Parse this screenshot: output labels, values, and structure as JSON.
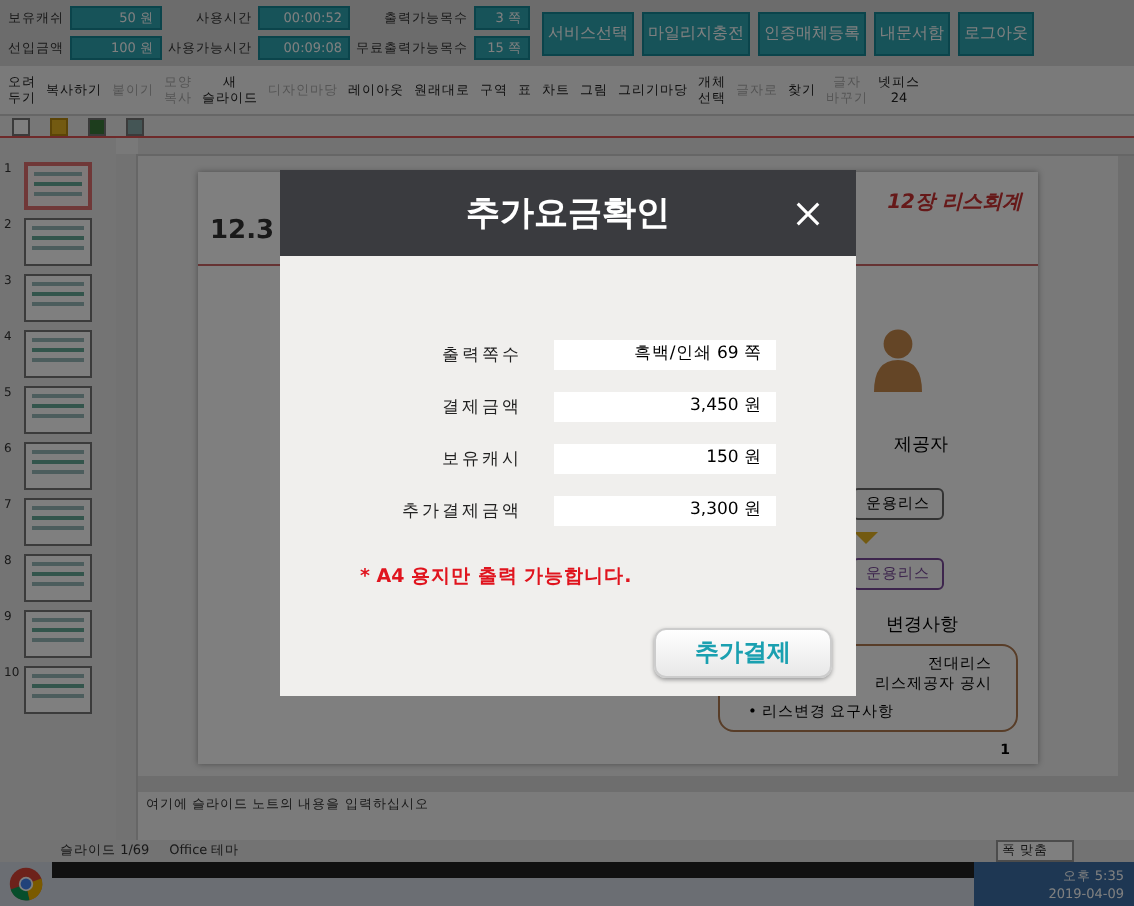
{
  "info_fields": [
    {
      "label": "보유캐쉬",
      "value": "50 원"
    },
    {
      "label": "사용시간",
      "value": "00:00:52"
    },
    {
      "label": "출력가능목수",
      "value": "3 쪽"
    },
    {
      "label": "선입금액",
      "value": "100 원"
    },
    {
      "label": "사용가능시간",
      "value": "00:09:08"
    },
    {
      "label": "무료출력가능목수",
      "value": "15 쪽"
    }
  ],
  "top_buttons": [
    "서비스선택",
    "마일리지충전",
    "인증매체등록",
    "내문서함",
    "로그아웃"
  ],
  "ribbon": [
    {
      "lines": [
        "오려",
        "두기"
      ],
      "disabled": false
    },
    {
      "lines": [
        "복사하기"
      ],
      "disabled": false
    },
    {
      "lines": [
        "붙이기"
      ],
      "disabled": true
    },
    {
      "lines": [
        "모양",
        "복사"
      ],
      "disabled": true
    },
    {
      "lines": [
        "새",
        "슬라이드"
      ],
      "disabled": false
    },
    {
      "lines": [
        "디자인마당"
      ],
      "disabled": true
    },
    {
      "lines": [
        "레이아웃"
      ],
      "disabled": false
    },
    {
      "lines": [
        "원래대로"
      ],
      "disabled": false
    },
    {
      "lines": [
        "구역"
      ],
      "disabled": false
    },
    {
      "lines": [
        "표"
      ],
      "disabled": false
    },
    {
      "lines": [
        "차트"
      ],
      "disabled": false
    },
    {
      "lines": [
        "그림"
      ],
      "disabled": false
    },
    {
      "lines": [
        "그리기마당"
      ],
      "disabled": false
    },
    {
      "lines": [
        "개체",
        "선택"
      ],
      "disabled": false
    },
    {
      "lines": [
        "글자로"
      ],
      "disabled": true
    },
    {
      "lines": [
        "찾기"
      ],
      "disabled": false
    },
    {
      "lines": [
        "글자",
        "바꾸기"
      ],
      "disabled": true
    },
    {
      "lines": [
        "넷피스",
        "24"
      ],
      "disabled": false
    }
  ],
  "thumbnails": [
    {
      "number": "1",
      "selected": true
    },
    {
      "number": "2",
      "selected": false
    },
    {
      "number": "3",
      "selected": false
    },
    {
      "number": "4",
      "selected": false
    },
    {
      "number": "5",
      "selected": false
    },
    {
      "number": "6",
      "selected": false
    },
    {
      "number": "7",
      "selected": false
    },
    {
      "number": "8",
      "selected": false
    },
    {
      "number": "9",
      "selected": false
    },
    {
      "number": "10",
      "selected": false
    }
  ],
  "slide": {
    "title": "12.3",
    "chapter": "12장 리스회계",
    "heading_1": "제공자",
    "tags": [
      "운용리스",
      "운용리스"
    ],
    "heading_2": "변경사항",
    "box_lines": [
      "전대리스",
      "리스제공자 공시"
    ],
    "bullet": "• 리스변경 요구사항",
    "page_number": "1"
  },
  "notes_placeholder": "여기에 슬라이드 노트의 내용을 입력하십시오",
  "status_bar": {
    "slide_counter": "슬라이드 1/69",
    "theme": "Office 테마",
    "zoom": "폭 맞춤"
  },
  "taskbar": {
    "time": "오후 5:35",
    "date": "2019-04-09"
  },
  "dialog": {
    "title": "추가요금확인",
    "rows": [
      {
        "label": "출력쪽수",
        "value": "흑백/인쇄 69 쪽"
      },
      {
        "label": "결제금액",
        "value": "3,450 원"
      },
      {
        "label": "보유캐시",
        "value": "150 원"
      },
      {
        "label": "추가결제금액",
        "value": "3,300 원"
      }
    ],
    "notice": "* A4 용지만 출력 가능합니다.",
    "button": "추가결제"
  }
}
